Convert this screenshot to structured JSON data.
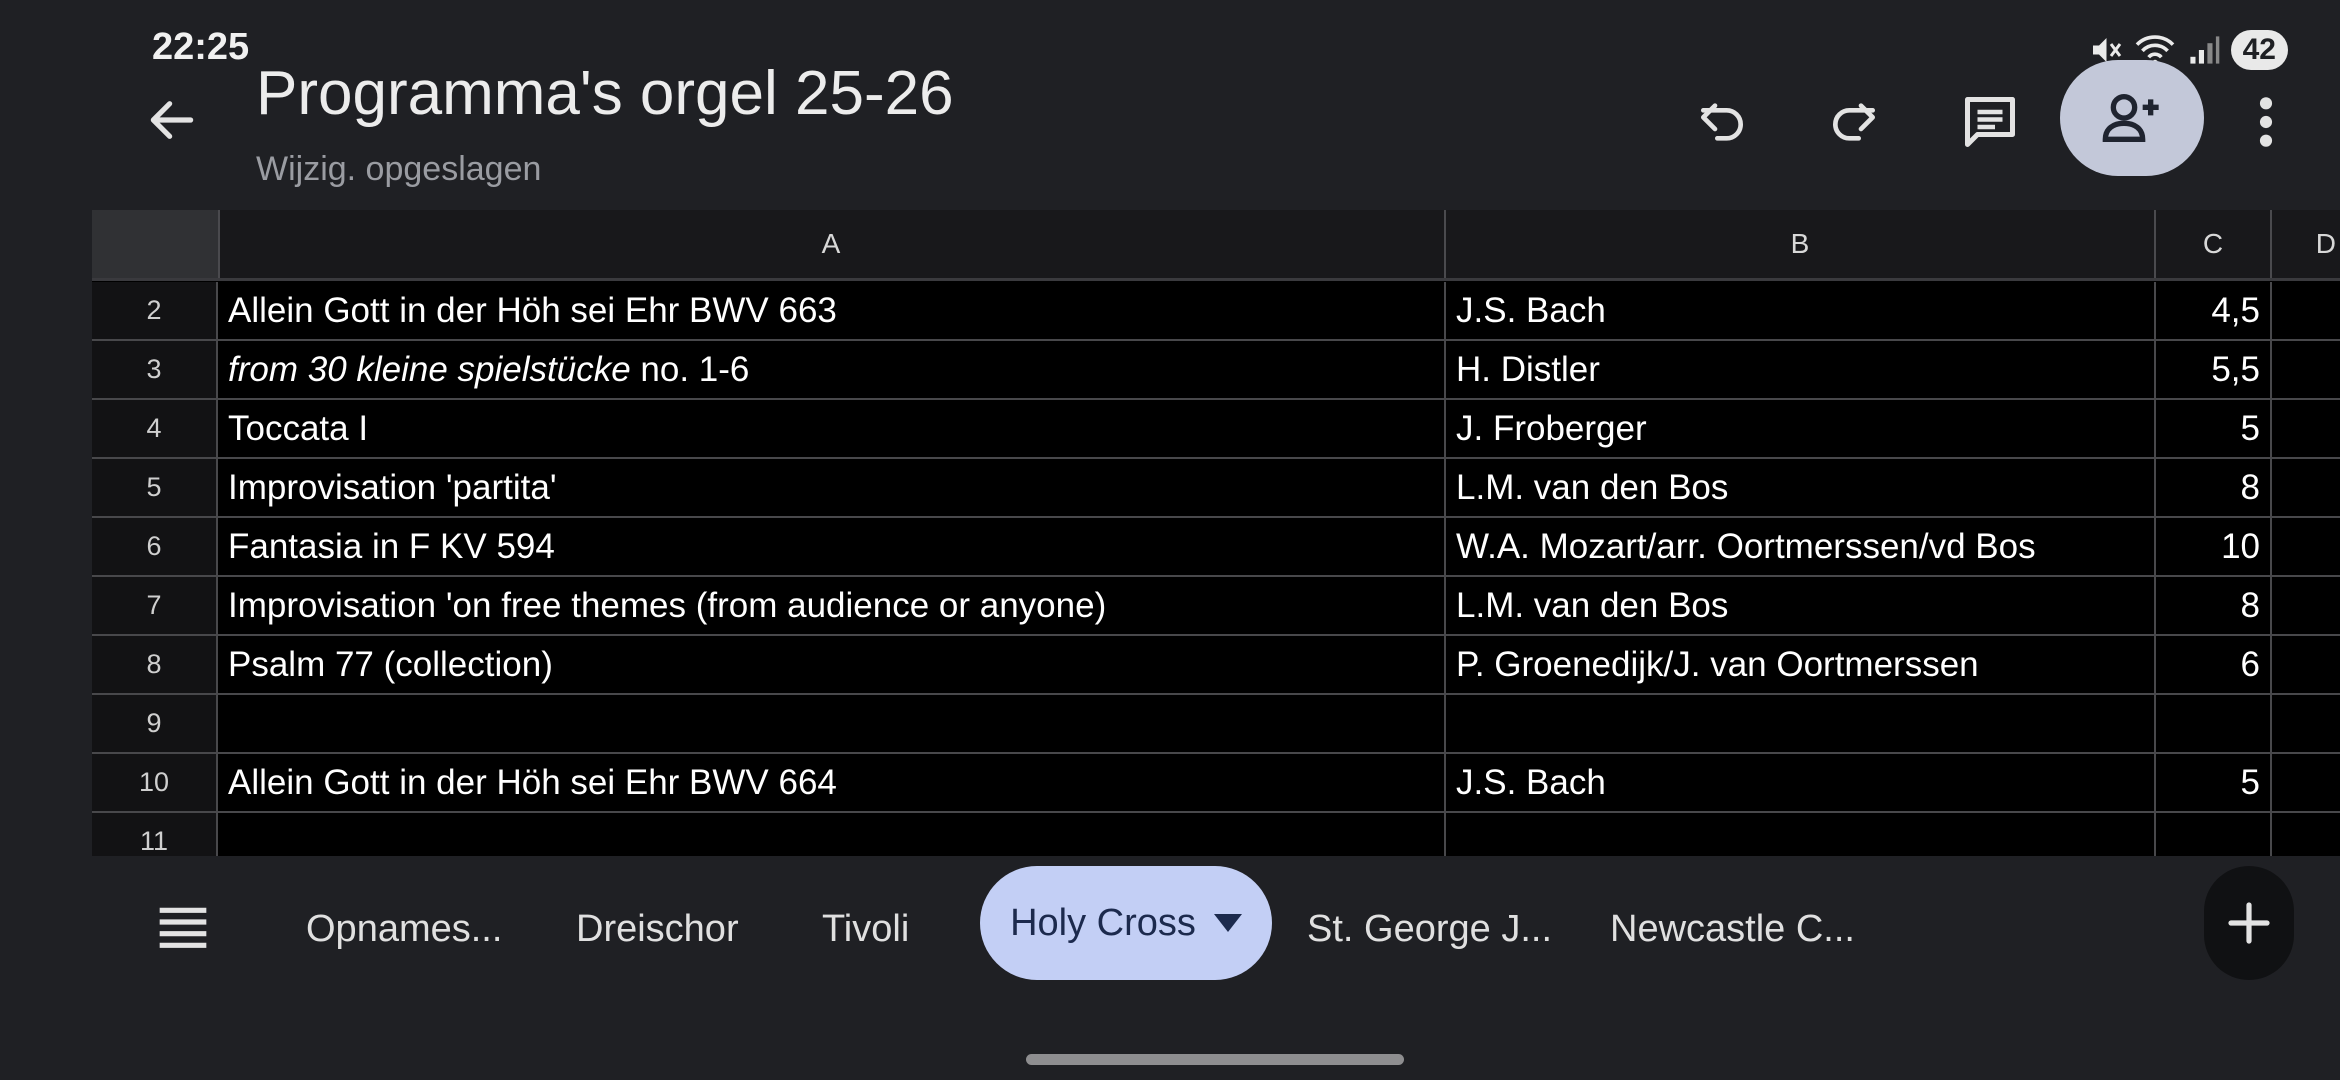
{
  "status_bar": {
    "time": "22:25",
    "battery": "42"
  },
  "header": {
    "title": "Programma's orgel 25-26",
    "subtitle": "Wijzig. opgeslagen"
  },
  "columns": [
    "A",
    "B",
    "C",
    "D"
  ],
  "rows": [
    {
      "num": "2",
      "a": "Allein Gott in der Höh sei Ehr BWV 663",
      "b": "J.S. Bach",
      "c": "4,5"
    },
    {
      "num": "3",
      "a_italic": "from 30 kleine spielstücke",
      "a": " no. 1-6",
      "b": "H. Distler",
      "c": "5,5"
    },
    {
      "num": "4",
      "a": "Toccata I",
      "b": "J. Froberger",
      "c": "5"
    },
    {
      "num": "5",
      "a": "Improvisation 'partita'",
      "b": "L.M. van den Bos",
      "c": "8"
    },
    {
      "num": "6",
      "a": "Fantasia in F KV 594",
      "b": "W.A. Mozart/arr. Oortmerssen/vd Bos",
      "c": "10"
    },
    {
      "num": "7",
      "a": "Improvisation 'on free themes (from audience or anyone)",
      "b": "L.M. van den Bos",
      "c": "8"
    },
    {
      "num": "8",
      "a": "Psalm 77 (collection)",
      "b": "P. Groenedijk/J. van Oortmerssen",
      "c": "6"
    },
    {
      "num": "9",
      "a": "",
      "b": "",
      "c": ""
    },
    {
      "num": "10",
      "a": "Allein Gott in der Höh sei Ehr BWV 664",
      "b": "J.S. Bach",
      "c": "5"
    },
    {
      "num": "11",
      "a": "",
      "b": "",
      "c": ""
    }
  ],
  "sheet_tabs": {
    "items": [
      "Opnames...",
      "Dreischor",
      "Tivoli",
      "Holy Cross",
      "St. George J...",
      "Newcastle C..."
    ],
    "active": "Holy Cross"
  },
  "icons": {
    "back": "arrow-left-icon",
    "undo": "undo-icon",
    "redo": "redo-icon",
    "comment": "comment-icon",
    "share": "person-add-icon",
    "more": "more-vert-icon",
    "menu": "list-menu-icon",
    "add": "plus-icon",
    "dropdown": "triangle-down-icon"
  },
  "colors": {
    "background": "#1f2024",
    "grid": "#000000",
    "active_tab": "#c3cff5",
    "share_button": "#c3c8d9"
  }
}
